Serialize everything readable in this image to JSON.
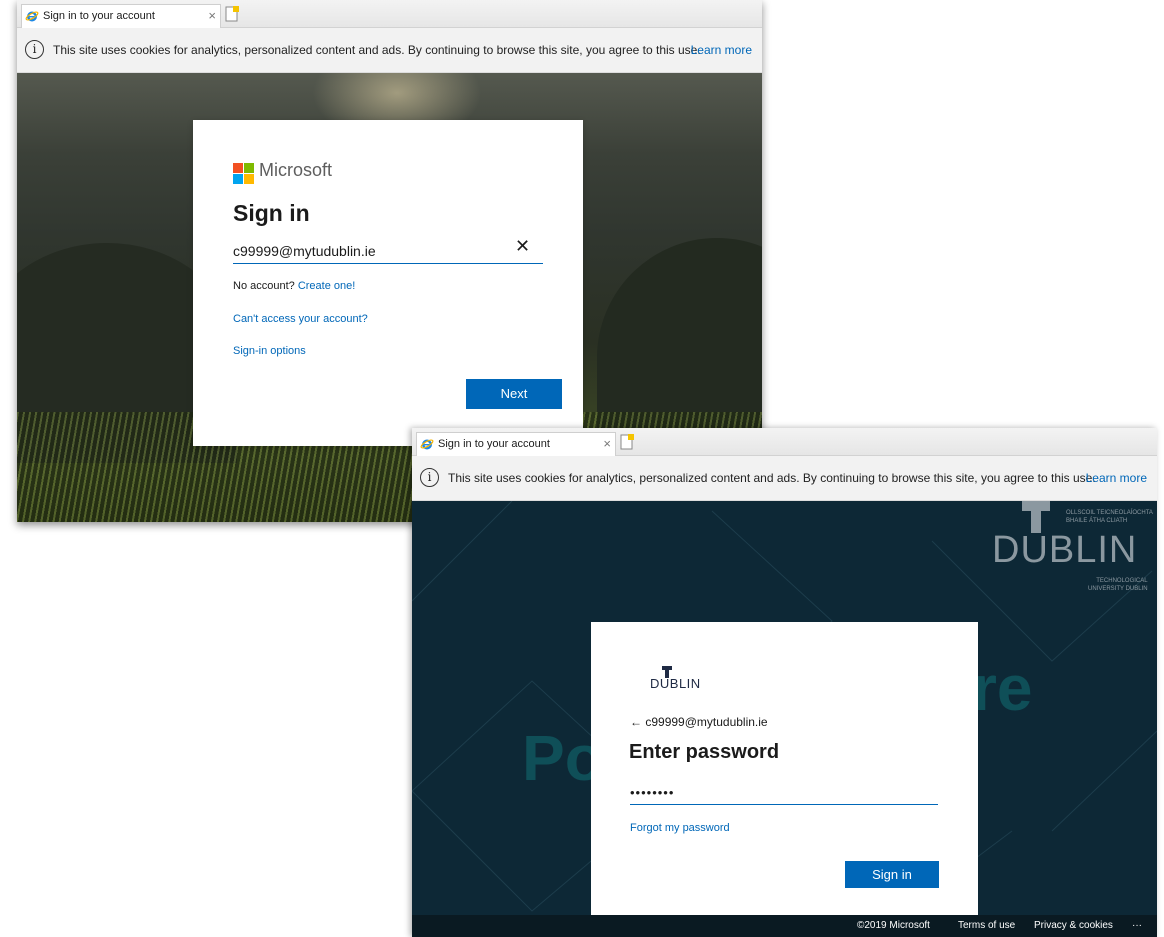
{
  "window1": {
    "tab_title": "Sign in to your account",
    "tab_close": "×",
    "cookie": {
      "text": "This site uses cookies for analytics, personalized content and ads. By continuing to browse this site, you agree to this use.",
      "learn_more": "Learn more",
      "info_glyph": "i"
    },
    "card": {
      "brand": "Microsoft",
      "title": "Sign in",
      "email_value": "c99999@mytudublin.ie",
      "clear_glyph": "✕",
      "no_account": "No account? ",
      "create_one": "Create one!",
      "cant_access": "Can't access your account?",
      "signin_options": "Sign-in options",
      "next_button": "Next"
    }
  },
  "window2": {
    "tab_title": "Sign in to your account",
    "tab_close": "×",
    "cookie": {
      "text": "This site uses cookies for analytics, personalized content and ads. By continuing to browse this site, you agree to this use.",
      "learn_more": "Learn more",
      "info_glyph": "i"
    },
    "background": {
      "text_left": "Po",
      "text_right": "re",
      "brand_word": "DUBLIN",
      "brand_top": "OLLSCOIL TEICNEOLAÍOCHTA\nBHAILE ÁTHA CLIATH",
      "brand_bottom": "TECHNOLOGICAL\nUNIVERSITY DUBLIN"
    },
    "card": {
      "logo_word": "DUBLIN",
      "back_arrow": "←",
      "email": "c99999@mytudublin.ie",
      "title": "Enter password",
      "password_mask": "••••••••",
      "forgot": "Forgot my password",
      "signin_button": "Sign in"
    },
    "footer": {
      "copyright": "©2019 Microsoft",
      "terms": "Terms of use",
      "privacy": "Privacy & cookies",
      "more": "···"
    }
  },
  "colors": {
    "accent": "#0067b8",
    "ms_red": "#f25022",
    "ms_green": "#7fba00",
    "ms_blue": "#00a4ef",
    "ms_yellow": "#ffb900",
    "tud_dark": "#0d2836"
  }
}
